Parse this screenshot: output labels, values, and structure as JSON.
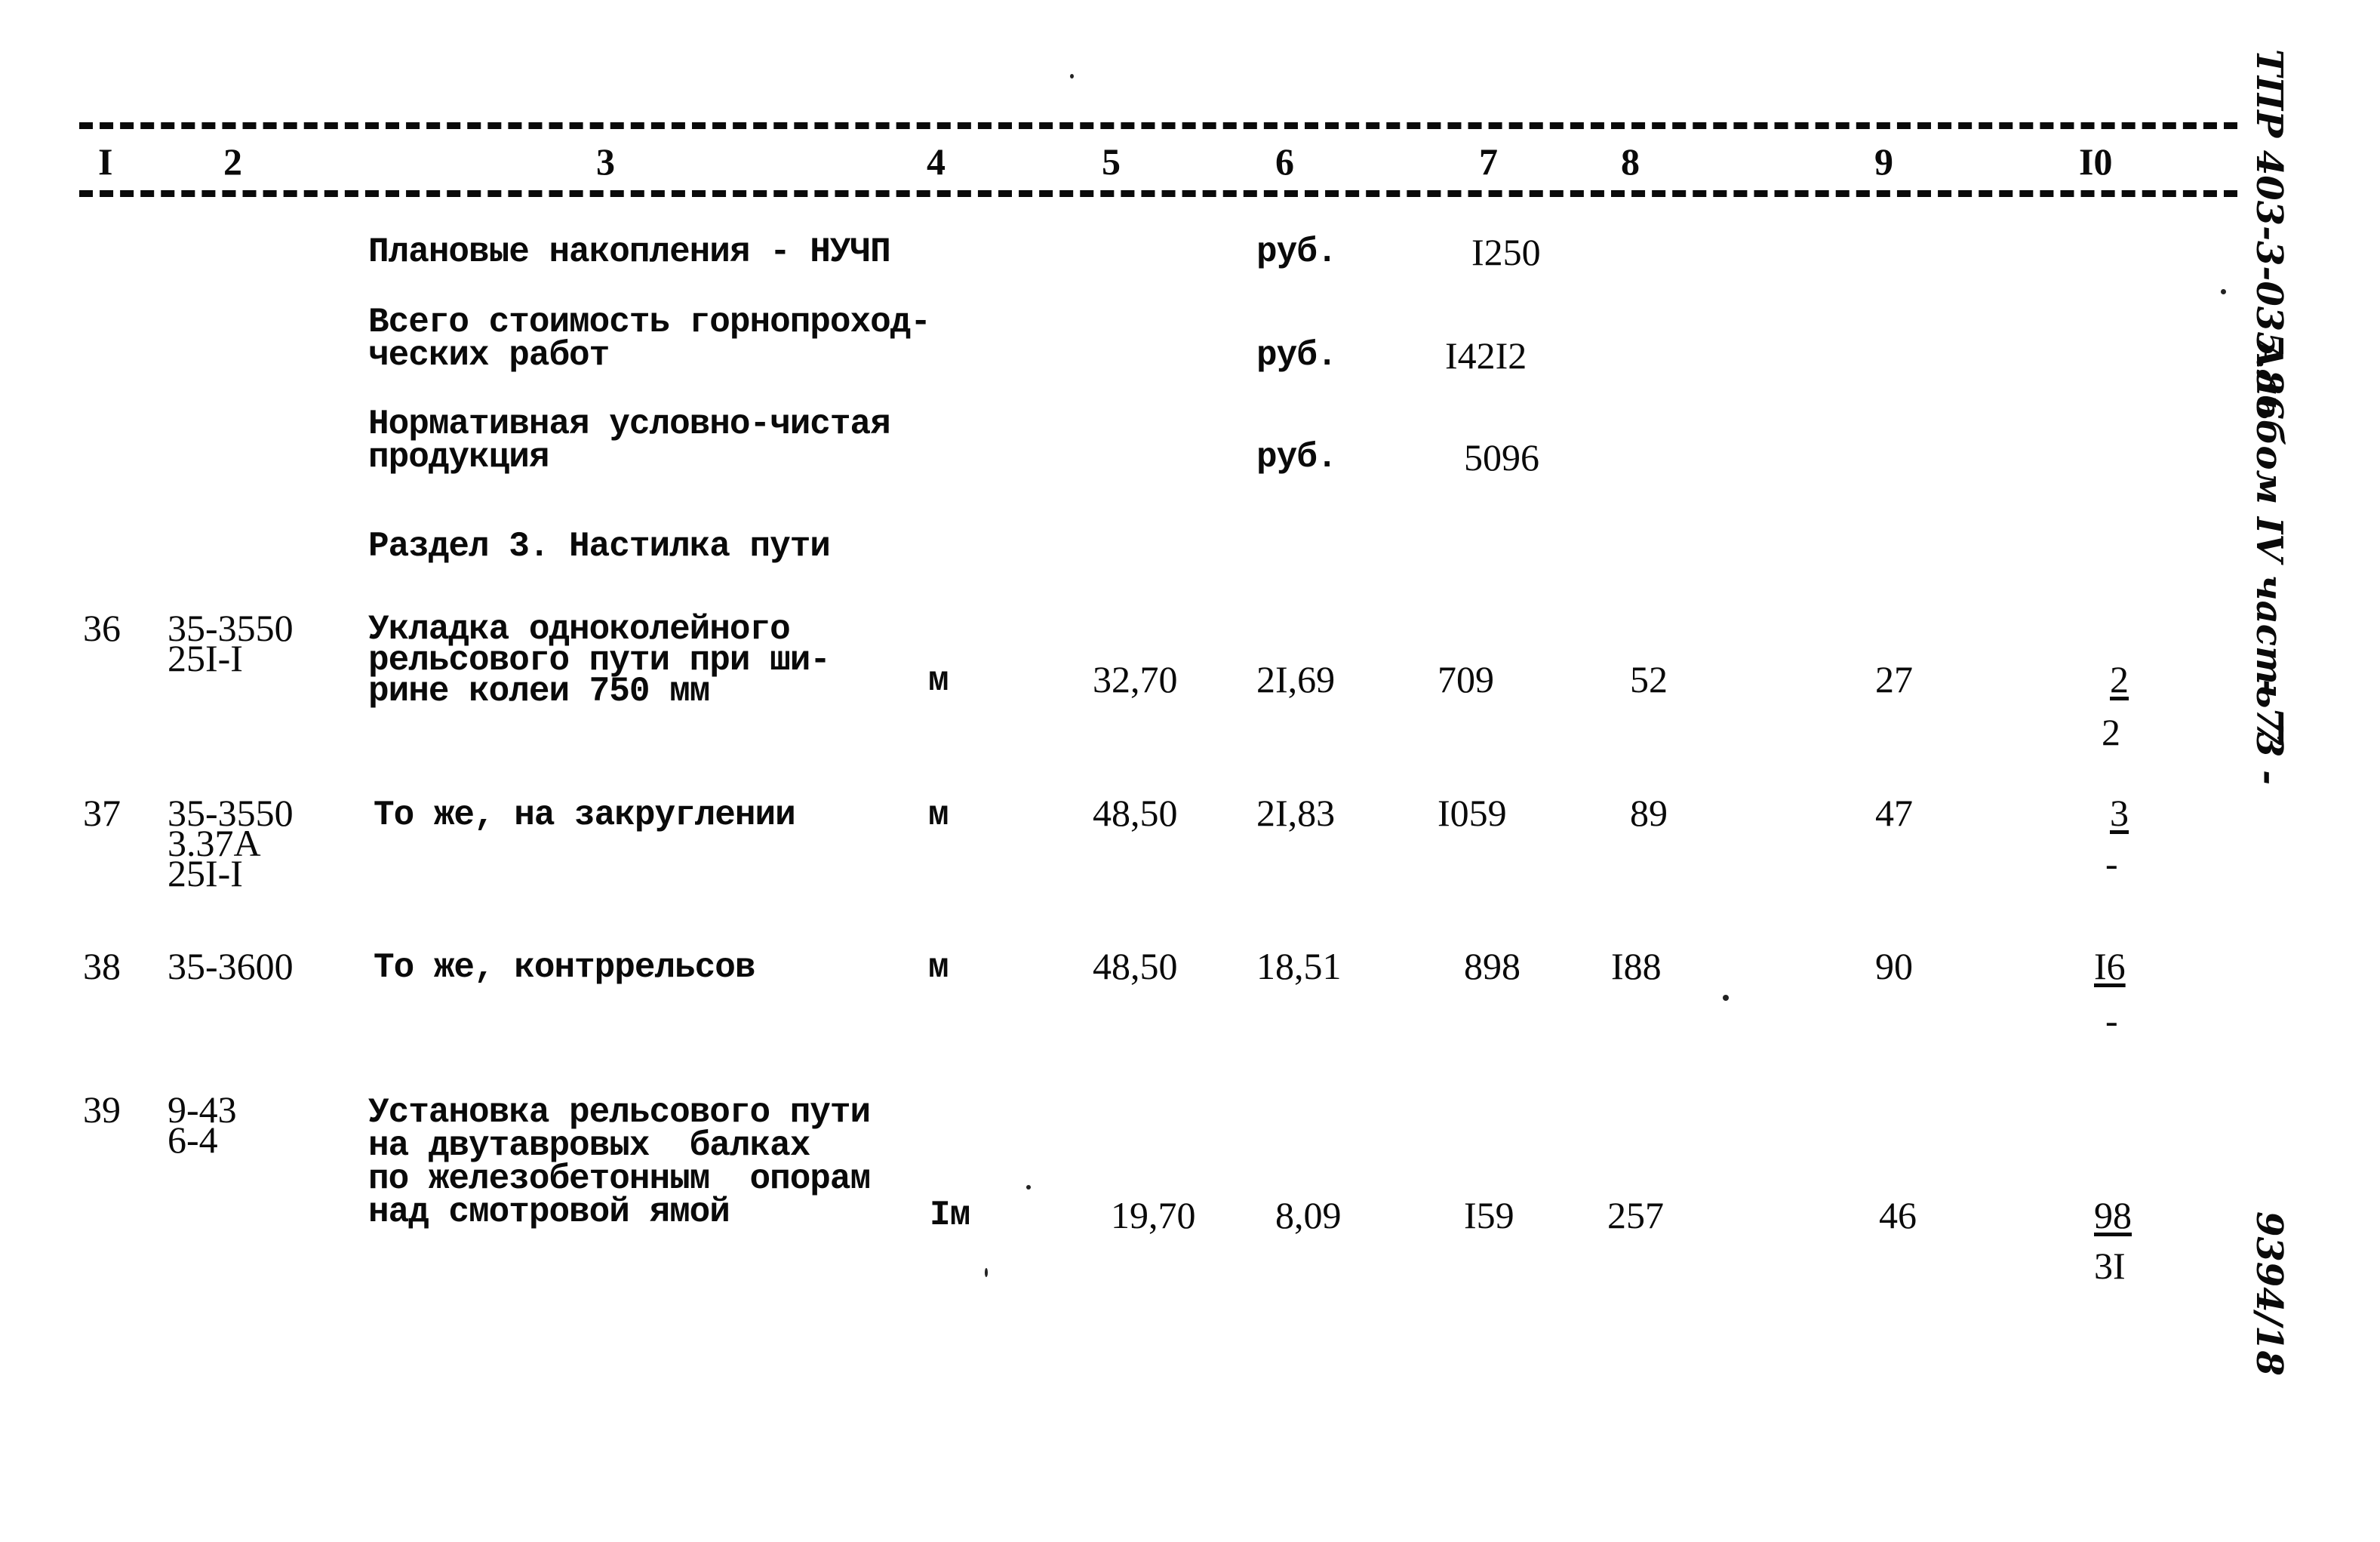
{
  "document": {
    "column_headers": [
      "I",
      "2",
      "3",
      "4",
      "5",
      "6",
      "7",
      "8",
      "9",
      "I0"
    ],
    "summary_rows": [
      {
        "name": [
          "Плановые накопления - НУЧП"
        ],
        "unit": "руб.",
        "total": "I250"
      },
      {
        "name": [
          "Всего стоимость горнопроход-",
          "ческих работ"
        ],
        "unit": "руб.",
        "total": "I42I2"
      },
      {
        "name": [
          "Нормативная условно-чистая",
          "продукция"
        ],
        "unit": "руб.",
        "total": "5096"
      }
    ],
    "section_title": "Раздел 3. Настилка пути",
    "rows": [
      {
        "num": "36",
        "code": [
          "35-3550",
          "25I-I"
        ],
        "name": [
          "Укладка одноколейного",
          "рельсового пути при ши-",
          "рине колеи 750 мм"
        ],
        "unit": "м",
        "quantity": "32,70",
        "price": "2I,69",
        "total": "709",
        "col8": "52",
        "col9": "27",
        "col10_top": "2",
        "col10_bottom": "2"
      },
      {
        "num": "37",
        "code": [
          "35-3550",
          "3.37А",
          "25I-I"
        ],
        "name": [
          "То же, на закруглении"
        ],
        "unit": "м",
        "quantity": "48,50",
        "price": "2I,83",
        "total": "I059",
        "col8": "89",
        "col9": "47",
        "col10_top": "3",
        "col10_bottom": "-"
      },
      {
        "num": "38",
        "code": [
          "35-3600"
        ],
        "name": [
          "То же, контррельсов"
        ],
        "unit": "м",
        "quantity": "48,50",
        "price": "18,51",
        "total": "898",
        "col8": "I88",
        "col9": "90",
        "col10_top": "I6",
        "col10_bottom": "-"
      },
      {
        "num": "39",
        "code": [
          "9-43",
          "6-4"
        ],
        "name": [
          "Установка рельсового пути",
          "на двутавровых  балках",
          "по железобетонным  опорам",
          "над смотровой ямой"
        ],
        "unit": "Iм",
        "quantity": "19,70",
        "price": "8,09",
        "total": "I59",
        "col8": "257",
        "col9": "46",
        "col10_top": "98",
        "col10_bottom": "3I"
      }
    ]
  },
  "margin": {
    "top_note": "ТПР 403-3-035.86",
    "middle_note": "Альбом IV часть 7",
    "page_number": "- 73 -",
    "bottom_note": "9394/18"
  }
}
